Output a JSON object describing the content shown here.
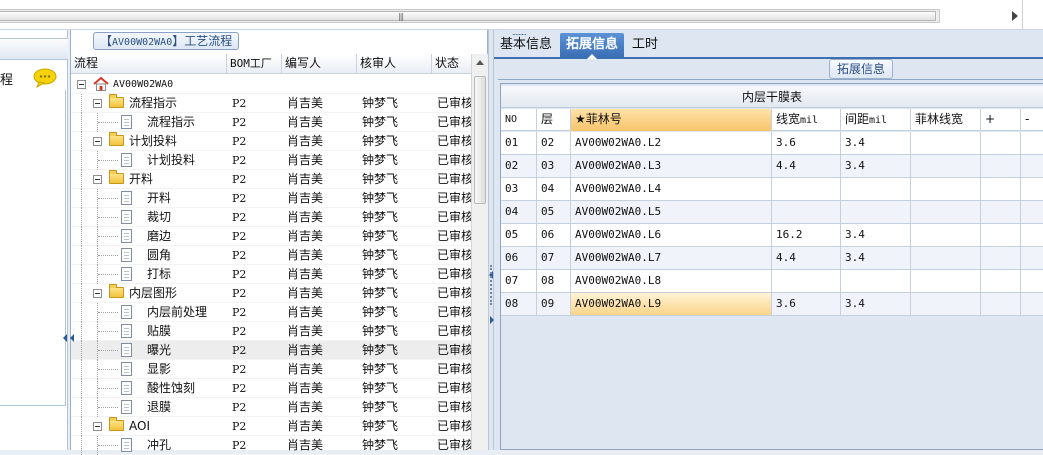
{
  "left_panel": {
    "fragment_text": "程"
  },
  "tree": {
    "title_prefix": "【",
    "title_code": "AV00W02WA0",
    "title_suffix": "】工艺流程",
    "columns": {
      "process": "流程",
      "bom_plant": "BOM工厂",
      "author": "编写人",
      "checker": "核审人",
      "status": "状态"
    },
    "root": {
      "label": "AV00W02WA0"
    },
    "rows": [
      {
        "label": "流程指示",
        "level": 1,
        "type": "folder",
        "plant": "P2",
        "author": "肖吉美",
        "checker": "钟梦飞",
        "status": "已审核"
      },
      {
        "label": "流程指示",
        "level": 2,
        "type": "doc",
        "plant": "P2",
        "author": "肖吉美",
        "checker": "钟梦飞",
        "status": "已审核"
      },
      {
        "label": "计划投料",
        "level": 1,
        "type": "folder",
        "plant": "P2",
        "author": "肖吉美",
        "checker": "钟梦飞",
        "status": "已审核"
      },
      {
        "label": "计划投料",
        "level": 2,
        "type": "doc",
        "plant": "P2",
        "author": "肖吉美",
        "checker": "钟梦飞",
        "status": "已审核"
      },
      {
        "label": "开料",
        "level": 1,
        "type": "folder",
        "plant": "P2",
        "author": "肖吉美",
        "checker": "钟梦飞",
        "status": "已审核"
      },
      {
        "label": "开料",
        "level": 2,
        "type": "doc",
        "plant": "P2",
        "author": "肖吉美",
        "checker": "钟梦飞",
        "status": "已审核"
      },
      {
        "label": "裁切",
        "level": 2,
        "type": "doc",
        "plant": "P2",
        "author": "肖吉美",
        "checker": "钟梦飞",
        "status": "已审核"
      },
      {
        "label": "磨边",
        "level": 2,
        "type": "doc",
        "plant": "P2",
        "author": "肖吉美",
        "checker": "钟梦飞",
        "status": "已审核"
      },
      {
        "label": "圆角",
        "level": 2,
        "type": "doc",
        "plant": "P2",
        "author": "肖吉美",
        "checker": "钟梦飞",
        "status": "已审核"
      },
      {
        "label": "打标",
        "level": 2,
        "type": "doc",
        "plant": "P2",
        "author": "肖吉美",
        "checker": "钟梦飞",
        "status": "已审核"
      },
      {
        "label": "内层图形",
        "level": 1,
        "type": "folder",
        "plant": "P2",
        "author": "肖吉美",
        "checker": "钟梦飞",
        "status": "已审核"
      },
      {
        "label": "内层前处理",
        "level": 2,
        "type": "doc",
        "plant": "P2",
        "author": "肖吉美",
        "checker": "钟梦飞",
        "status": "已审核"
      },
      {
        "label": "贴膜",
        "level": 2,
        "type": "doc",
        "plant": "P2",
        "author": "肖吉美",
        "checker": "钟梦飞",
        "status": "已审核"
      },
      {
        "label": "曝光",
        "level": 2,
        "type": "doc",
        "plant": "P2",
        "author": "肖吉美",
        "checker": "钟梦飞",
        "status": "已审核",
        "selected": true
      },
      {
        "label": "显影",
        "level": 2,
        "type": "doc",
        "plant": "P2",
        "author": "肖吉美",
        "checker": "钟梦飞",
        "status": "已审核"
      },
      {
        "label": "酸性蚀刻",
        "level": 2,
        "type": "doc",
        "plant": "P2",
        "author": "肖吉美",
        "checker": "钟梦飞",
        "status": "已审核"
      },
      {
        "label": "退膜",
        "level": 2,
        "type": "doc",
        "plant": "P2",
        "author": "肖吉美",
        "checker": "钟梦飞",
        "status": "已审核"
      },
      {
        "label": "AOI",
        "level": 1,
        "type": "folder",
        "plant": "P2",
        "author": "肖吉美",
        "checker": "钟梦飞",
        "status": "已审核"
      },
      {
        "label": "冲孔",
        "level": 2,
        "type": "doc",
        "plant": "P2",
        "author": "肖吉美",
        "checker": "钟梦飞",
        "status": "已审核"
      }
    ]
  },
  "tabs": [
    {
      "label": "基本信息",
      "active": false
    },
    {
      "label": "拓展信息",
      "active": true
    },
    {
      "label": "工时",
      "active": false
    }
  ],
  "extension": {
    "group_label": "拓展信息",
    "table_caption": "内层干膜表",
    "columns": {
      "no": "NO",
      "layer": "层",
      "film_no": "★菲林号",
      "line_width": "线宽",
      "line_width_unit": "mil",
      "spacing": "间距",
      "spacing_unit": "mil",
      "film_line_width": "菲林线宽",
      "add": "+",
      "remove": "-"
    },
    "rows": [
      {
        "no": "01",
        "layer": "02",
        "film_no": "AV00W02WA0.L2",
        "line_width": "3.6",
        "spacing": "3.4"
      },
      {
        "no": "02",
        "layer": "03",
        "film_no": "AV00W02WA0.L3",
        "line_width": "4.4",
        "spacing": "3.4"
      },
      {
        "no": "03",
        "layer": "04",
        "film_no": "AV00W02WA0.L4",
        "line_width": "",
        "spacing": ""
      },
      {
        "no": "04",
        "layer": "05",
        "film_no": "AV00W02WA0.L5",
        "line_width": "",
        "spacing": ""
      },
      {
        "no": "05",
        "layer": "06",
        "film_no": "AV00W02WA0.L6",
        "line_width": "16.2",
        "spacing": "3.4"
      },
      {
        "no": "06",
        "layer": "07",
        "film_no": "AV00W02WA0.L7",
        "line_width": "4.4",
        "spacing": "3.4"
      },
      {
        "no": "07",
        "layer": "08",
        "film_no": "AV00W02WA0.L8",
        "line_width": "",
        "spacing": ""
      },
      {
        "no": "08",
        "layer": "09",
        "film_no": "AV00W02WA0.L9",
        "line_width": "3.6",
        "spacing": "3.4",
        "active": true
      }
    ]
  },
  "colors": {
    "tab_active": "#3a6fb5",
    "sorted_header": "#f7c46a",
    "folder": "#f1c33a",
    "chat_icon": "#f5d20a",
    "home_roof": "#d23b2b"
  }
}
